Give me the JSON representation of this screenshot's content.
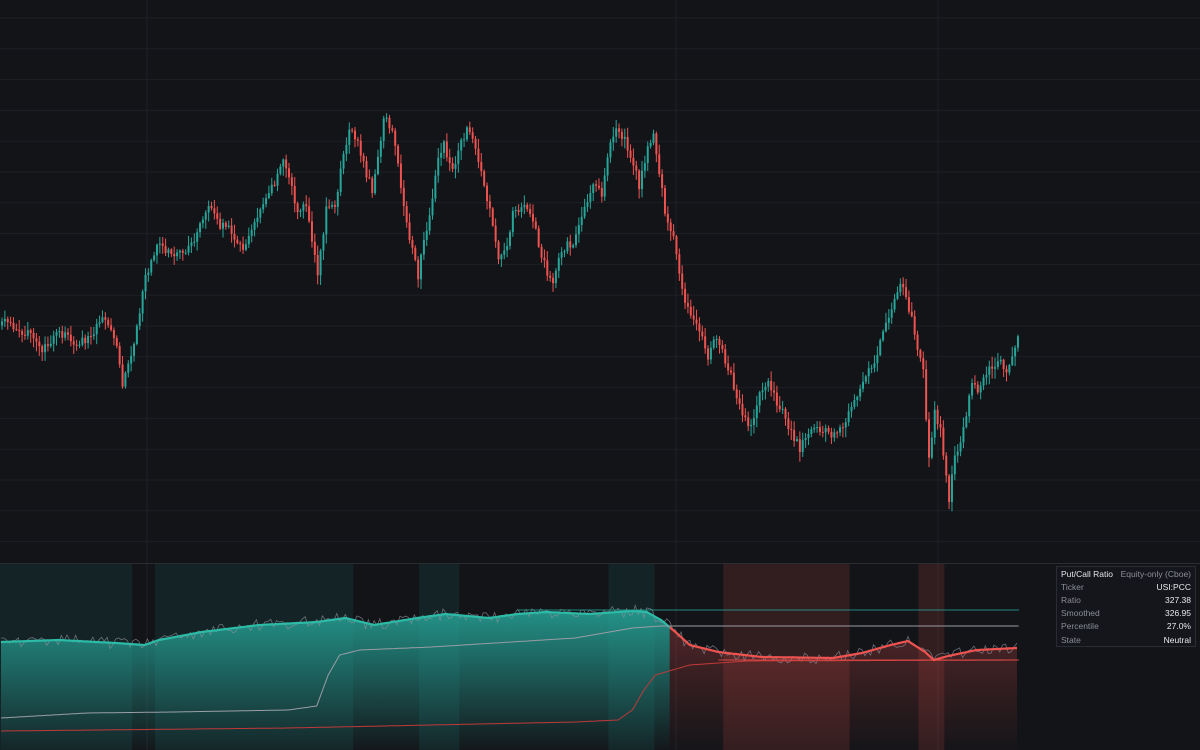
{
  "chart_data": [
    {
      "type": "candlestick",
      "panel": "price",
      "title": "",
      "xlabel": "",
      "ylabel": "",
      "up_color": "#26a69a",
      "down_color": "#ef5350",
      "grid": true,
      "anchors": [
        [
          0,
          320
        ],
        [
          8,
          332
        ],
        [
          14,
          348
        ],
        [
          20,
          332
        ],
        [
          26,
          343
        ],
        [
          30,
          340
        ],
        [
          34,
          323
        ],
        [
          36,
          318
        ],
        [
          40,
          350
        ],
        [
          42,
          385
        ],
        [
          46,
          345
        ],
        [
          50,
          278
        ],
        [
          54,
          243
        ],
        [
          57,
          250
        ],
        [
          62,
          255
        ],
        [
          66,
          245
        ],
        [
          70,
          220
        ],
        [
          73,
          205
        ],
        [
          76,
          226
        ],
        [
          80,
          230
        ],
        [
          84,
          252
        ],
        [
          88,
          220
        ],
        [
          92,
          195
        ],
        [
          95,
          182
        ],
        [
          98,
          162
        ],
        [
          100,
          175
        ],
        [
          103,
          212
        ],
        [
          106,
          205
        ],
        [
          108,
          245
        ],
        [
          110,
          272
        ],
        [
          113,
          210
        ],
        [
          116,
          205
        ],
        [
          118,
          170
        ],
        [
          121,
          130
        ],
        [
          124,
          140
        ],
        [
          126,
          165
        ],
        [
          129,
          190
        ],
        [
          131,
          160
        ],
        [
          133,
          118
        ],
        [
          136,
          128
        ],
        [
          139,
          185
        ],
        [
          141,
          225
        ],
        [
          143,
          252
        ],
        [
          145,
          276
        ],
        [
          147,
          242
        ],
        [
          150,
          196
        ],
        [
          152,
          158
        ],
        [
          154,
          145
        ],
        [
          157,
          170
        ],
        [
          160,
          142
        ],
        [
          162,
          128
        ],
        [
          165,
          150
        ],
        [
          168,
          182
        ],
        [
          171,
          228
        ],
        [
          173,
          255
        ],
        [
          176,
          248
        ],
        [
          178,
          215
        ],
        [
          181,
          204
        ],
        [
          184,
          212
        ],
        [
          186,
          230
        ],
        [
          188,
          255
        ],
        [
          190,
          272
        ],
        [
          192,
          285
        ],
        [
          194,
          258
        ],
        [
          197,
          243
        ],
        [
          199,
          248
        ],
        [
          201,
          228
        ],
        [
          203,
          210
        ],
        [
          206,
          188
        ],
        [
          209,
          193
        ],
        [
          212,
          145
        ],
        [
          214,
          130
        ],
        [
          217,
          138
        ],
        [
          220,
          163
        ],
        [
          222,
          185
        ],
        [
          225,
          150
        ],
        [
          227,
          135
        ],
        [
          229,
          170
        ],
        [
          231,
          212
        ],
        [
          234,
          240
        ],
        [
          236,
          272
        ],
        [
          238,
          300
        ],
        [
          241,
          318
        ],
        [
          244,
          340
        ],
        [
          246,
          360
        ],
        [
          249,
          336
        ],
        [
          251,
          352
        ],
        [
          254,
          376
        ],
        [
          256,
          395
        ],
        [
          258,
          415
        ],
        [
          261,
          425
        ],
        [
          264,
          395
        ],
        [
          267,
          378
        ],
        [
          270,
          402
        ],
        [
          272,
          410
        ],
        [
          275,
          432
        ],
        [
          278,
          448
        ],
        [
          280,
          435
        ],
        [
          283,
          428
        ],
        [
          286,
          430
        ],
        [
          289,
          436
        ],
        [
          292,
          428
        ],
        [
          296,
          410
        ],
        [
          299,
          388
        ],
        [
          302,
          372
        ],
        [
          305,
          355
        ],
        [
          307,
          330
        ],
        [
          310,
          308
        ],
        [
          313,
          282
        ],
        [
          315,
          297
        ],
        [
          317,
          318
        ],
        [
          319,
          352
        ],
        [
          321,
          373
        ],
        [
          323,
          460
        ],
        [
          325,
          412
        ],
        [
          327,
          428
        ],
        [
          330,
          500
        ],
        [
          332,
          455
        ],
        [
          334,
          440
        ],
        [
          336,
          412
        ],
        [
          338,
          385
        ],
        [
          340,
          392
        ],
        [
          342,
          374
        ],
        [
          346,
          365
        ],
        [
          348,
          360
        ],
        [
          350,
          372
        ],
        [
          352,
          355
        ],
        [
          354,
          335
        ]
      ],
      "total_candles": 355
    },
    {
      "type": "area",
      "panel": "indicator",
      "title": "Put/Call Ratio",
      "series": [
        {
          "name": "Smoothed",
          "role": "oscillator",
          "color_bull": "#26a69a",
          "color_bear": "#ef5350"
        },
        {
          "name": "Ratio",
          "role": "raw",
          "color": "#8f939c"
        }
      ],
      "upper_level": 610,
      "middle_level": 626,
      "lower_level": 660,
      "osc_anchors": [
        [
          0,
          642
        ],
        [
          20,
          640
        ],
        [
          40,
          643
        ],
        [
          50,
          645
        ],
        [
          55,
          640
        ],
        [
          70,
          632
        ],
        [
          90,
          625
        ],
        [
          110,
          622
        ],
        [
          120,
          618
        ],
        [
          130,
          625
        ],
        [
          145,
          618
        ],
        [
          155,
          614
        ],
        [
          170,
          618
        ],
        [
          180,
          614
        ],
        [
          190,
          612
        ],
        [
          205,
          614
        ],
        [
          220,
          611
        ],
        [
          225,
          612
        ],
        [
          230,
          620
        ],
        [
          235,
          632
        ],
        [
          240,
          645
        ],
        [
          250,
          652
        ],
        [
          265,
          657
        ],
        [
          290,
          658
        ],
        [
          300,
          653
        ],
        [
          310,
          645
        ],
        [
          316,
          641
        ],
        [
          322,
          652
        ],
        [
          325,
          660
        ],
        [
          330,
          656
        ],
        [
          340,
          650
        ],
        [
          354,
          648
        ]
      ],
      "slow_anchors": [
        [
          0,
          718
        ],
        [
          30,
          713
        ],
        [
          60,
          712
        ],
        [
          100,
          710
        ],
        [
          110,
          706
        ],
        [
          114,
          675
        ],
        [
          118,
          655
        ],
        [
          125,
          650
        ],
        [
          150,
          647
        ],
        [
          200,
          638
        ],
        [
          220,
          628
        ],
        [
          230,
          626
        ],
        [
          354,
          626
        ]
      ],
      "red_anchors": [
        [
          0,
          731
        ],
        [
          100,
          728
        ],
        [
          200,
          722
        ],
        [
          215,
          720
        ],
        [
          220,
          710
        ],
        [
          224,
          690
        ],
        [
          228,
          675
        ],
        [
          240,
          665
        ],
        [
          260,
          661
        ],
        [
          354,
          660
        ]
      ],
      "zones": [
        {
          "start": 0,
          "end": 45,
          "state": "bull"
        },
        {
          "start": 54,
          "end": 122,
          "state": "bull"
        },
        {
          "start": 146,
          "end": 159,
          "state": "bull"
        },
        {
          "start": 212,
          "end": 227,
          "state": "bull"
        },
        {
          "start": 252,
          "end": 295,
          "state": "bear"
        },
        {
          "start": 320,
          "end": 328,
          "state": "bear"
        }
      ]
    }
  ],
  "info_table": {
    "title": "Put/Call Ratio",
    "subtitle": "Equity-only (Cboe)",
    "rows": [
      {
        "label": "Ticker",
        "value": "USI:PCC"
      },
      {
        "label": "Ratio",
        "value": "327.38"
      },
      {
        "label": "Smoothed",
        "value": "326.95"
      },
      {
        "label": "Percentile",
        "value": "27.0%"
      },
      {
        "label": "State",
        "value": "Neutral"
      }
    ]
  }
}
